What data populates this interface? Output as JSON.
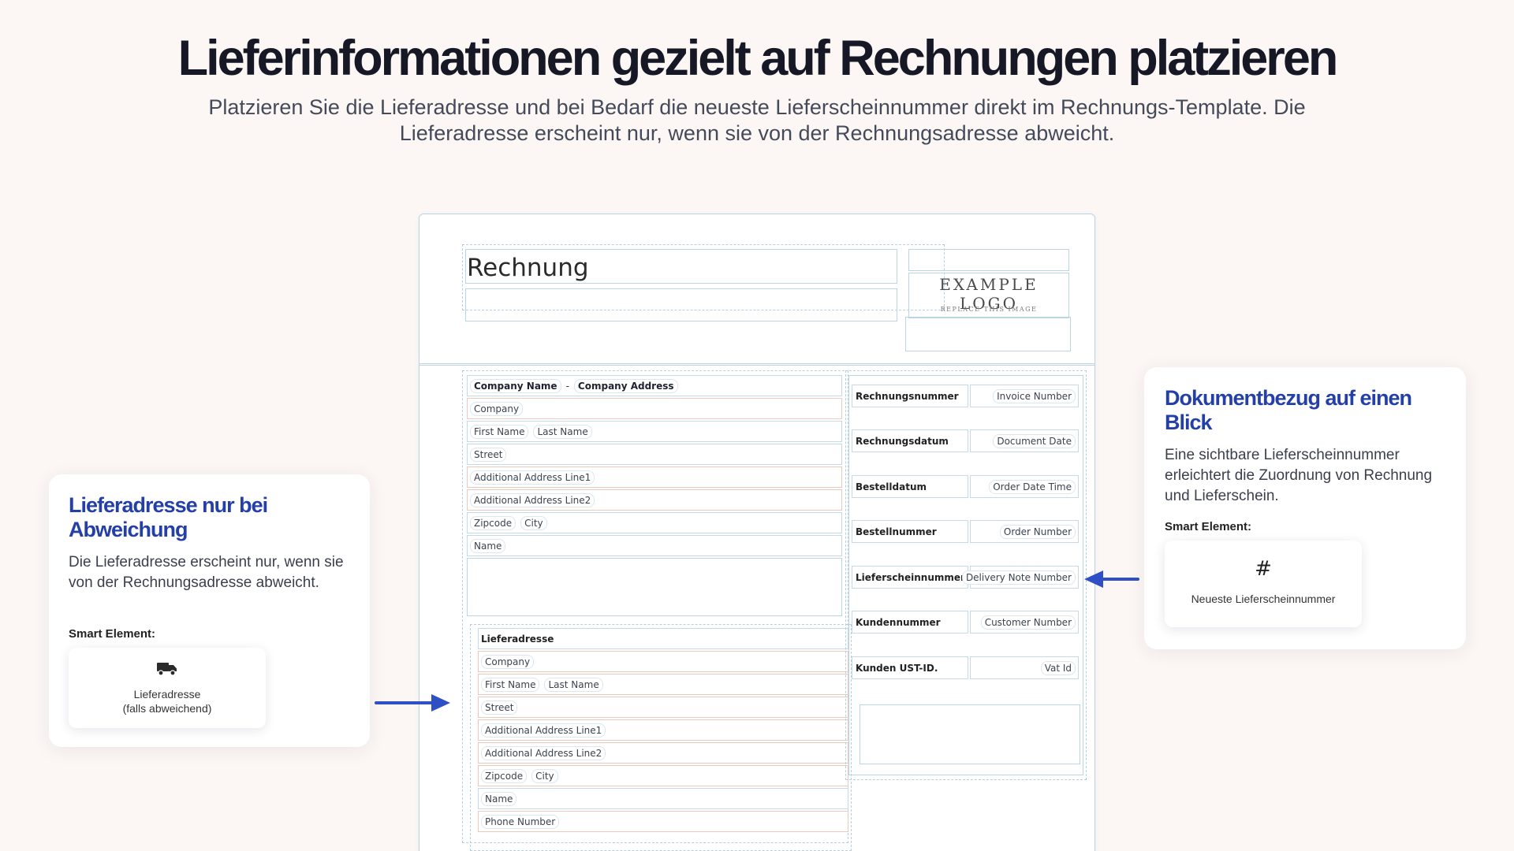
{
  "hero": {
    "title": "Lieferinformationen gezielt auf Rechnungen platzieren",
    "subtitle": "Platzieren Sie die Lieferadresse und bei Bedarf die neueste Lieferscheinnummer direkt im Rechnungs-Template. Die Lieferadresse erscheint nur, wenn sie von der Rechnungsadresse abweicht."
  },
  "left_card": {
    "title": "Lieferadresse nur bei Abweichung",
    "body": "Die Lieferadresse erscheint nur, wenn sie von der Rechnungsadresse abweicht.",
    "smart_label": "Smart Element:",
    "chip_icon": "truck-icon",
    "chip_line1": "Lieferadresse",
    "chip_line2": "(falls abweichend)"
  },
  "right_card": {
    "title": "Dokumentbezug auf einen Blick",
    "body": "Eine sichtbare Lieferscheinnummer erleichtert die Zuordnung von Rechnung und Lieferschein.",
    "smart_label": "Smart Element:",
    "chip_icon": "hash-icon",
    "chip_symbol": "#",
    "chip_line1": "Neueste Lieferscheinnummer"
  },
  "invoice": {
    "title": "Rechnung",
    "logo_main": "EXAMPLE LOGO",
    "logo_sub": "REPLACE THIS IMAGE",
    "sender": {
      "company_name": "Company Name",
      "separator": "-",
      "company_address": "Company Address"
    },
    "billing": {
      "company": "Company",
      "first_name": "First Name",
      "last_name": "Last Name",
      "street": "Street",
      "address1": "Additional Address Line1",
      "address2": "Additional Address Line2",
      "zipcode": "Zipcode",
      "city": "City",
      "name": "Name"
    },
    "shipping": {
      "heading": "Lieferadresse",
      "company": "Company",
      "first_name": "First Name",
      "last_name": "Last Name",
      "street": "Street",
      "address1": "Additional Address Line1",
      "address2": "Additional Address Line2",
      "zipcode": "Zipcode",
      "city": "City",
      "name": "Name",
      "phone": "Phone Number"
    },
    "meta": [
      {
        "label": "Rechnungsnummer",
        "value": "Invoice Number"
      },
      {
        "label": "Rechnungsdatum",
        "value": "Document Date"
      },
      {
        "label": "Bestelldatum",
        "value": "Order Date Time"
      },
      {
        "label": "Bestellnummer",
        "value": "Order Number"
      },
      {
        "label": "Lieferscheinnummer",
        "value": "Delivery Note Number"
      },
      {
        "label": "Kundennummer",
        "value": "Customer Number"
      },
      {
        "label": "Kunden UST-ID.",
        "value": "Vat Id"
      }
    ]
  },
  "colors": {
    "accent": "#2440a8",
    "arrow": "#2f4fc4",
    "background": "#fcf7f4"
  }
}
